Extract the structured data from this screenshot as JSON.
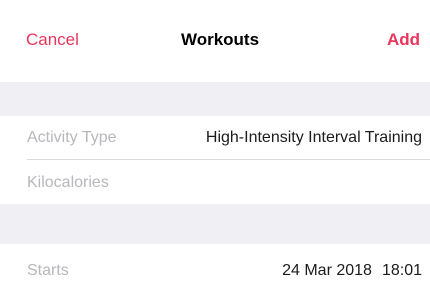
{
  "nav": {
    "cancel_label": "Cancel",
    "title": "Workouts",
    "add_label": "Add"
  },
  "form": {
    "activity_type": {
      "label": "Activity Type",
      "value": "High-Intensity Interval Training"
    },
    "kilocalories": {
      "label": "Kilocalories",
      "value": ""
    },
    "starts": {
      "label": "Starts",
      "date": "24 Mar 2018",
      "time": "18:01"
    }
  },
  "colors": {
    "accent": "#e8365d",
    "background_group": "#efeff4",
    "label_gray": "#b7b7bc"
  }
}
